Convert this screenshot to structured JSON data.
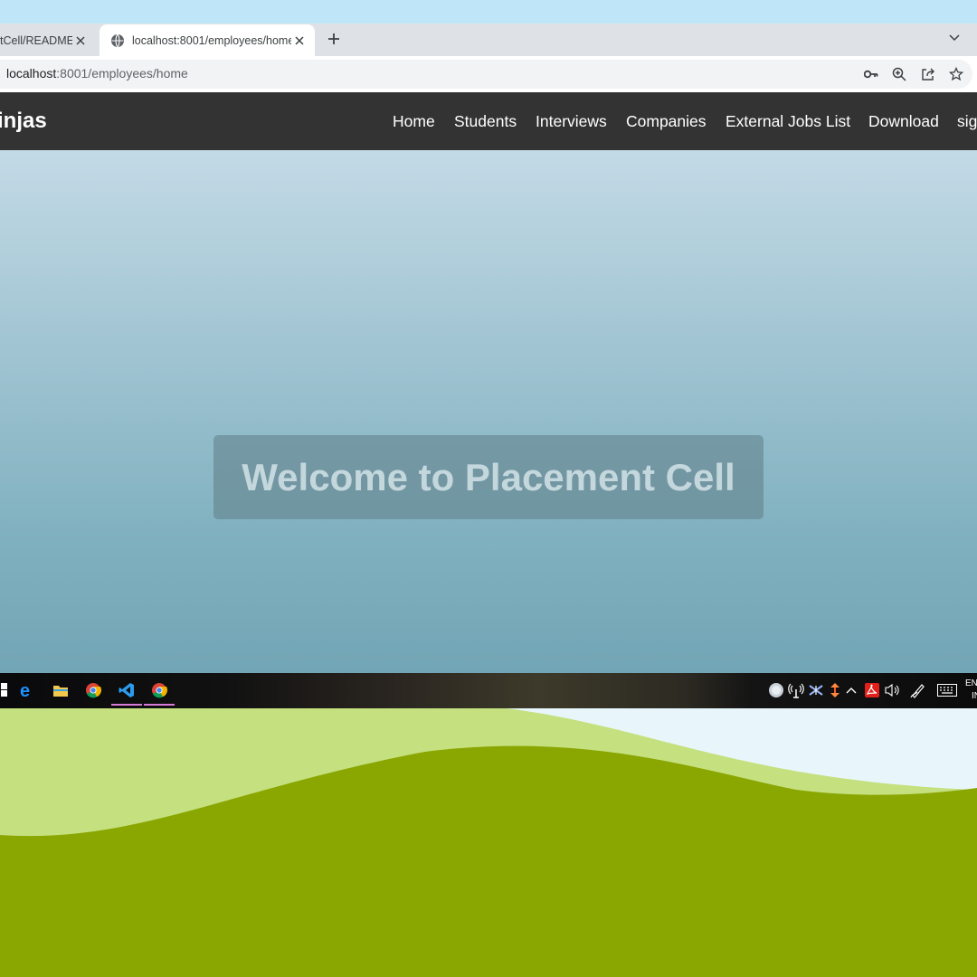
{
  "browser": {
    "tabs": [
      {
        "title": "tCell/README.m",
        "active": false
      },
      {
        "title": "localhost:8001/employees/home",
        "active": true
      }
    ],
    "url_host": "localhost",
    "url_rest": ":8001/employees/home",
    "icons": [
      "close-icon",
      "globe-icon",
      "new-tab-icon",
      "tab-search-chevron-icon",
      "key-icon",
      "zoom-icon",
      "share-icon",
      "bookmark-star-icon"
    ]
  },
  "site": {
    "brand": "injas",
    "nav": [
      "Home",
      "Students",
      "Interviews",
      "Companies",
      "External Jobs List",
      "Download",
      "sig"
    ],
    "hero_title": "Welcome to Placement Cell",
    "navbar_color": "#333333"
  },
  "taskbar": {
    "apps": [
      "start-icon",
      "edge-icon",
      "file-explorer-icon",
      "chrome-icon",
      "vscode-icon",
      "chrome-active-icon"
    ],
    "tray": [
      "network-icon",
      "antenna-icon",
      "bluetooth-icon",
      "arrows-icon",
      "chevron-up-icon",
      "acrobat-icon",
      "volume-icon",
      "pen-icon",
      "keyboard-icon"
    ],
    "lang_line1": "EN",
    "lang_line2": "IN"
  }
}
